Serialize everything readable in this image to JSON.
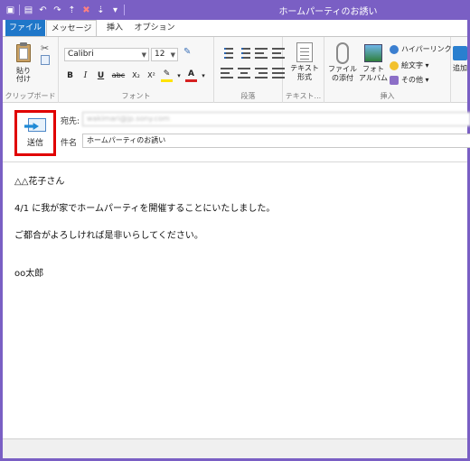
{
  "window": {
    "title": "ホームパーティのお誘い",
    "accent_color": "#7a5fc4"
  },
  "qat": {
    "icons": [
      "app-icon",
      "save-icon",
      "undo-icon",
      "redo-icon",
      "up-icon",
      "delete-icon",
      "down-icon",
      "more-icon"
    ]
  },
  "tabs": {
    "file": "ファイル",
    "message": "メッセージ",
    "insert": "挿入",
    "options": "オプション"
  },
  "ribbon": {
    "clipboard": {
      "paste_label_1": "貼り",
      "paste_label_2": "付け",
      "group_label": "クリップボード"
    },
    "font": {
      "font_name": "Calibri",
      "font_size": "12",
      "bold": "B",
      "italic": "I",
      "underline": "U",
      "strike": "abc",
      "subscript": "X₂",
      "superscript": "X²",
      "font_color_letter": "A",
      "group_label": "フォント"
    },
    "paragraph": {
      "group_label": "段落"
    },
    "text": {
      "button_1": "テキスト",
      "button_2": "形式",
      "group_label": "テキスト..."
    },
    "insert": {
      "attach_1": "ファイル",
      "attach_2": "の添付",
      "album_1": "フォト",
      "album_2": "アルバム",
      "hyperlink": "ハイパーリンク",
      "emoticon": "絵文字 ▾",
      "other": "その他 ▾",
      "group_label": "挿入"
    },
    "add_label": "追加"
  },
  "compose": {
    "send_label": "送信",
    "to_label": "宛先:",
    "to_value": "wakimari@jp.sony.com",
    "subject_label": "件名",
    "subject_value": "ホームパーティのお誘い"
  },
  "body": {
    "line1": "△△花子さん",
    "line2": "4/1 に我が家でホームパーティを開催することにいたしました。",
    "line3": "ご都合がよろしければ是非いらしてください。",
    "line4": "oo太郎"
  }
}
